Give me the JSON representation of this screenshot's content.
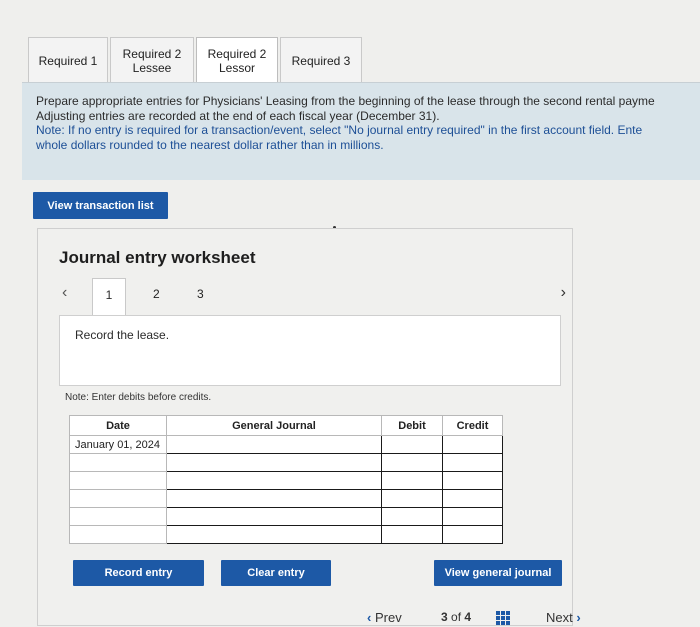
{
  "tabs": [
    {
      "label": "Required 1"
    },
    {
      "label": "Required 2\nLessee"
    },
    {
      "label": "Required 2\nLessor"
    },
    {
      "label": "Required 3"
    }
  ],
  "instructions": {
    "line1": "Prepare appropriate entries for Physicians' Leasing from the beginning of the lease through the second rental payme",
    "line2": "Adjusting entries are recorded at the end of each fiscal year (December 31).",
    "note1": "Note: If no entry is required for a transaction/event, select \"No journal entry required\" in the first account field. Ente",
    "note2": "whole dollars rounded to the nearest dollar rather than in millions."
  },
  "view_transaction_list_label": "View transaction list",
  "worksheet": {
    "title": "Journal entry worksheet",
    "entries": [
      "1",
      "2",
      "3"
    ],
    "prev_icon": "chevron-left-icon",
    "next_icon": "chevron-right-icon",
    "record_text": "Record the lease.",
    "note": "Note: Enter debits before credits.",
    "table": {
      "headers": [
        "Date",
        "General Journal",
        "Debit",
        "Credit"
      ],
      "rows": [
        {
          "date": "January 01, 2024"
        },
        {
          "date": ""
        },
        {
          "date": ""
        },
        {
          "date": ""
        },
        {
          "date": ""
        },
        {
          "date": ""
        }
      ]
    },
    "record_entry_label": "Record entry",
    "clear_entry_label": "Clear entry",
    "view_general_journal_label": "View general journal"
  },
  "nav": {
    "prev_label": "Prev",
    "current": "3",
    "of_label": "of",
    "total": "4",
    "next_label": "Next"
  },
  "colors": {
    "primary": "#1d59a6",
    "instructions_bg": "#d9e4ea",
    "note_text": "#1d4f96"
  }
}
